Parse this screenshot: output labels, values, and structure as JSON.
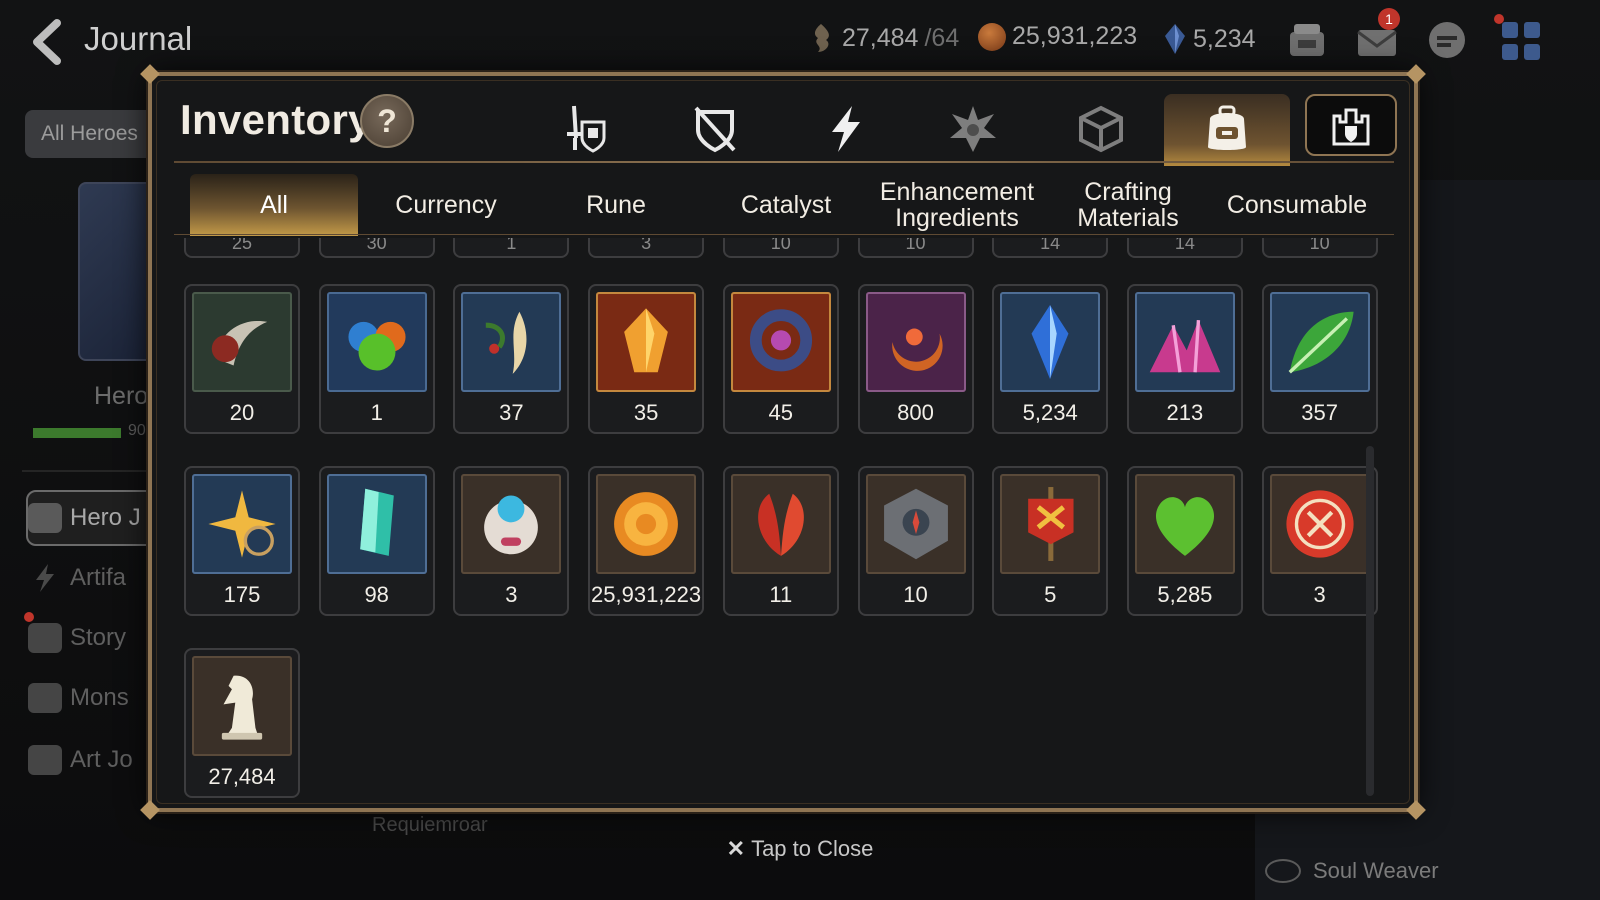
{
  "header": {
    "title": "Journal",
    "resources": [
      {
        "name": "stamina",
        "value": "27,484",
        "max": "/64",
        "icon": "stamina-icon",
        "color": "#7f6e57"
      },
      {
        "name": "gold",
        "value": "25,931,223",
        "icon": "gold-icon",
        "color": "#b4622d"
      },
      {
        "name": "skystone",
        "value": "5,234",
        "icon": "skystone-icon",
        "color": "#3e5e9a"
      }
    ],
    "mail_badge": "1"
  },
  "sidebar": {
    "filter_button": "All Heroes",
    "hero_label": "Hero",
    "hero_bar_value": "90",
    "items": [
      {
        "label": "Hero J",
        "icon": "hero-journal-icon",
        "active": true
      },
      {
        "label": "Artifa",
        "icon": "artifact-icon",
        "active": false
      },
      {
        "label": "Story",
        "icon": "story-icon",
        "active": false
      },
      {
        "label": "Mons",
        "icon": "monster-icon",
        "active": false
      },
      {
        "label": "Art Jo",
        "icon": "art-journal-icon",
        "active": false
      }
    ]
  },
  "background_texts": {
    "requiemroar": "Requiemroar",
    "soul_weaver": "Soul Weaver"
  },
  "inventory": {
    "title": "Inventory",
    "help": "?",
    "category_tabs": [
      {
        "name": "weapon-armor-tab",
        "icon": "sword-shield-icon"
      },
      {
        "name": "accessory-tab",
        "icon": "broken-shield-icon"
      },
      {
        "name": "artifact-tab",
        "icon": "lightning-icon"
      },
      {
        "name": "exclusive-equipment-tab",
        "icon": "spiked-emblem-icon"
      },
      {
        "name": "material-box-tab",
        "icon": "cube-icon"
      },
      {
        "name": "items-tab",
        "icon": "backpack-icon",
        "active": true
      },
      {
        "name": "storage-tab",
        "icon": "castle-shield-icon"
      }
    ],
    "sub_tabs": [
      {
        "label": "All",
        "active": true
      },
      {
        "label": "Currency"
      },
      {
        "label": "Rune"
      },
      {
        "label": "Catalyst"
      },
      {
        "label": "Enhancement Ingredients"
      },
      {
        "label": "Crafting Materials"
      },
      {
        "label": "Consumable"
      }
    ],
    "partial_row": [
      "25",
      "30",
      "1",
      "3",
      "10",
      "10",
      "14",
      "14",
      "10"
    ],
    "items": [
      {
        "qty": "20",
        "icon": "claw-icon",
        "bg": "#2c3a30",
        "frame": "#4a5a4b"
      },
      {
        "qty": "1",
        "icon": "orbs-icon",
        "bg": "#223a5c",
        "frame": "#4a6a92"
      },
      {
        "qty": "37",
        "icon": "root-herb-icon",
        "bg": "#233a55",
        "frame": "#4f6e95"
      },
      {
        "qty": "35",
        "icon": "flame-crystal-icon",
        "bg": "#7a2a14",
        "frame": "#c4883e"
      },
      {
        "qty": "45",
        "icon": "coiled-ribbon-icon",
        "bg": "#7a2a14",
        "frame": "#c4883e"
      },
      {
        "qty": "800",
        "icon": "crescent-emblem-icon",
        "bg": "#4b2349",
        "frame": "#8a5a88"
      },
      {
        "qty": "5,234",
        "icon": "blue-gem-icon",
        "bg": "#233a55",
        "frame": "#4f6e95"
      },
      {
        "qty": "213",
        "icon": "crystal-pile-icon",
        "bg": "#233a55",
        "frame": "#4f6e95"
      },
      {
        "qty": "357",
        "icon": "green-leaf-icon",
        "bg": "#233a55",
        "frame": "#4f6e95"
      },
      {
        "qty": "175",
        "icon": "star-pendant-icon",
        "bg": "#233a55",
        "frame": "#4f6e95"
      },
      {
        "qty": "98",
        "icon": "teal-crystal-icon",
        "bg": "#233a55",
        "frame": "#4f6e95"
      },
      {
        "qty": "3",
        "icon": "pet-pod-icon",
        "bg": "#3a3028",
        "frame": "#5a4a3a"
      },
      {
        "qty": "25,931,223",
        "icon": "gold-coin-icon",
        "bg": "#3a3028",
        "frame": "#5a4a3a"
      },
      {
        "qty": "11",
        "icon": "red-leaves-icon",
        "bg": "#3a3028",
        "frame": "#5a4a3a"
      },
      {
        "qty": "10",
        "icon": "stone-compass-icon",
        "bg": "#3a3028",
        "frame": "#5a4a3a"
      },
      {
        "qty": "5",
        "icon": "war-banner-icon",
        "bg": "#3a3028",
        "frame": "#5a4a3a"
      },
      {
        "qty": "5,285",
        "icon": "green-heart-icon",
        "bg": "#3a3028",
        "frame": "#5a4a3a"
      },
      {
        "qty": "3",
        "icon": "red-seal-icon",
        "bg": "#3a3028",
        "frame": "#5a4a3a"
      },
      {
        "qty": "27,484",
        "icon": "knight-chess-icon",
        "bg": "#3a3028",
        "frame": "#5a4a3a"
      }
    ]
  },
  "footer": {
    "close_label": "Tap to Close"
  }
}
